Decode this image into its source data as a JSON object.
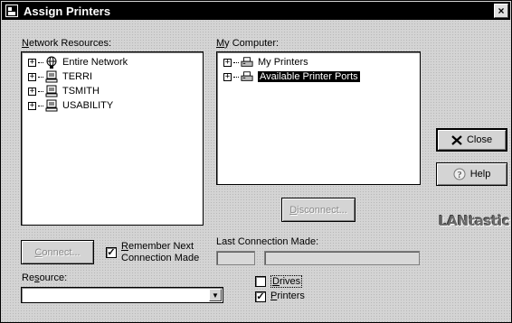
{
  "window": {
    "title": "Assign Printers",
    "close_glyph": "×"
  },
  "network": {
    "label_u": "N",
    "label_rest": "etwork Resources:",
    "items": [
      {
        "label": "Entire Network",
        "icon": "globe-icon"
      },
      {
        "label": "TERRI",
        "icon": "computer-icon"
      },
      {
        "label": "TSMITH",
        "icon": "computer-icon"
      },
      {
        "label": "USABILITY",
        "icon": "computer-icon"
      }
    ]
  },
  "computer": {
    "label_u": "M",
    "label_rest": "y Computer:",
    "items": [
      {
        "label": "My Printers",
        "icon": "printer-icon"
      },
      {
        "label": "Available Printer Ports",
        "icon": "printer-icon",
        "selected": true
      }
    ]
  },
  "buttons": {
    "connect_u": "C",
    "connect_rest": "onnect...",
    "disconnect_u": "D",
    "disconnect_rest": "isconnect...",
    "close": "Close",
    "help": "Help"
  },
  "remember": {
    "line1_u": "R",
    "line1_rest": "emember Next",
    "line2": "Connection Made",
    "checked": true,
    "check": "✓"
  },
  "last_connection": {
    "label": "Last Connection Made:",
    "field1": "",
    "field2": ""
  },
  "resource": {
    "label_pre": "Re",
    "label_u": "s",
    "label_post": "ource:",
    "value": "",
    "arrow": "▼"
  },
  "options": {
    "drives_u": "D",
    "drives_rest": "rives",
    "drives_checked": false,
    "printers_u": "P",
    "printers_rest": "rinters",
    "printers_checked": true,
    "check": "✓"
  },
  "logo": "LANtastic",
  "colors": {
    "titlebar": "#000000",
    "face": "#d4d4d4",
    "selection": "#000000"
  }
}
